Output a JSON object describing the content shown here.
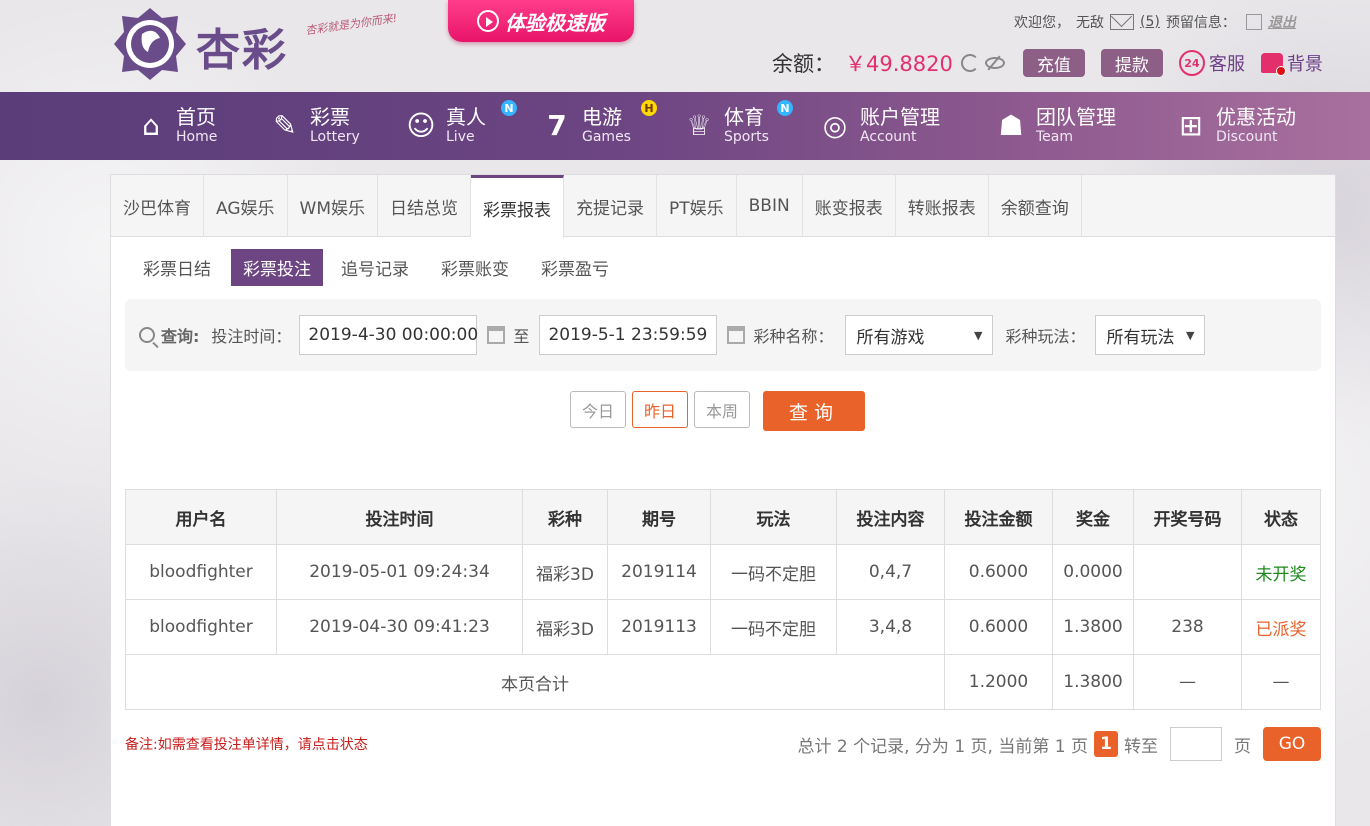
{
  "header": {
    "brand": "杏彩",
    "slogan": "杏彩就是为你而来!",
    "promo_label": "体验极速版",
    "welcome": "欢迎您，",
    "username": "无敌",
    "mail_count": "(5)",
    "reserved_info": "预留信息：",
    "logout": "退出",
    "balance_label": "余额：",
    "balance_value": "￥49.8820",
    "deposit": "充值",
    "withdraw": "提款",
    "service": "客服",
    "background": "背景"
  },
  "nav": [
    {
      "zh": "首页",
      "en": "Home",
      "icon": "home-icon"
    },
    {
      "zh": "彩票",
      "en": "Lottery",
      "icon": "ticket-icon"
    },
    {
      "zh": "真人",
      "en": "Live",
      "icon": "dealer-icon",
      "badge": "N"
    },
    {
      "zh": "电游",
      "en": "Games",
      "icon": "slot-seven-icon",
      "badge": "H"
    },
    {
      "zh": "体育",
      "en": "Sports",
      "icon": "trophy-icon",
      "badge": "N"
    },
    {
      "zh": "账户管理",
      "en": "Account",
      "icon": "coin-icon"
    },
    {
      "zh": "团队管理",
      "en": "Team",
      "icon": "team-icon"
    },
    {
      "zh": "优惠活动",
      "en": "Discount",
      "icon": "gift-icon"
    }
  ],
  "tabs": [
    "沙巴体育",
    "AG娱乐",
    "WM娱乐",
    "日结总览",
    "彩票报表",
    "充提记录",
    "PT娱乐",
    "BBIN",
    "账变报表",
    "转账报表",
    "余额查询"
  ],
  "active_tab": "彩票报表",
  "subtabs": [
    "彩票日结",
    "彩票投注",
    "追号记录",
    "彩票账变",
    "彩票盈亏"
  ],
  "filter": {
    "query_label": "查询:",
    "time_label": "投注时间：",
    "start": "2019-4-30 00:00:00",
    "to": "至",
    "end": "2019-5-1 23:59:59",
    "lottery_label": "彩种名称：",
    "lottery_value": "所有游戏",
    "play_label": "彩种玩法：",
    "play_value": "所有玩法",
    "today": "今日",
    "yesterday": "昨日",
    "this_week": "本周",
    "search": "查询"
  },
  "table": {
    "headers": [
      "用户名",
      "投注时间",
      "彩种",
      "期号",
      "玩法",
      "投注内容",
      "投注金额",
      "奖金",
      "开奖号码",
      "状态"
    ],
    "rows": [
      [
        "bloodfighter",
        "2019-05-01 09:24:34",
        "福彩3D",
        "2019114",
        "一码不定胆",
        "0,4,7",
        "0.6000",
        "0.0000",
        "",
        "未开奖"
      ],
      [
        "bloodfighter",
        "2019-04-30 09:41:23",
        "福彩3D",
        "2019113",
        "一码不定胆",
        "3,4,8",
        "0.6000",
        "1.3800",
        "238",
        "已派奖"
      ]
    ],
    "total_label": "本页合计",
    "total_amount": "1.2000",
    "total_prize": "1.3800",
    "dash": "—"
  },
  "note": "备注:如需查看投注单详情，请点击状态",
  "pager": {
    "summary": "总计 2 个记录, 分为 1 页, 当前第 1 页",
    "current": "1",
    "goto": "转至",
    "page_unit": "页",
    "go": "GO"
  },
  "colors": {
    "nav_start": "#5a3d79",
    "nav_end": "#a8709e",
    "accent": "#e8622a",
    "balance": "#e3306c",
    "pending": "#1d8a1d"
  }
}
